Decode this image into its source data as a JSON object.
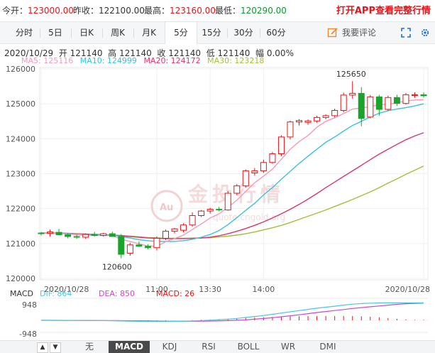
{
  "quote": {
    "open_label": "今开：",
    "open_value": "123000.00",
    "prev_label": "昨收：",
    "prev_value": "122100.00",
    "high_label": "最高：",
    "high_value": "123160.00",
    "low_label": "最低：",
    "low_value": "120290.00",
    "app_promo": "打开APP查看完整行情"
  },
  "tabs": [
    "分时",
    "5日",
    "日K",
    "周K",
    "月K",
    "5分",
    "15分",
    "30分",
    "60分"
  ],
  "active_tab": "5分",
  "comment_label": "我要评论",
  "info": {
    "date": "2020/10/29",
    "open_label": "开",
    "open": "121140",
    "high_label": "高",
    "high": "121140",
    "close_label": "收",
    "close": "121140",
    "low_label": "低",
    "low": "121140",
    "amp_label": "幅",
    "amp": "0.00%"
  },
  "ma": {
    "ma5": "MA5: 125116",
    "ma10": "MA10: 124999",
    "ma20": "MA20: 124172",
    "ma30": "MA30: 123218"
  },
  "colors": {
    "up": "#e0161a",
    "down": "#1ba32c",
    "ma5": "#f39bb6",
    "ma10": "#3cc1dc",
    "ma20": "#d6386b",
    "ma30": "#a5be3a",
    "dif": "#4cc6dc",
    "dea": "#c74bc2"
  },
  "macd": {
    "title": "MACD",
    "dif": "DIF: 864",
    "dea": "DEA: 850",
    "macd": "MACD: 26",
    "ytop": "948",
    "ybot": "-948"
  },
  "bottom_tabs": [
    "无",
    "MACD",
    "KDJ",
    "RSI",
    "BOLL",
    "WR",
    "DMI"
  ],
  "active_bottom_tab": "MACD",
  "watermark": "金投行情",
  "watermark_url": "quote.cngold.org",
  "chart_data": {
    "type": "candlestick",
    "y_ticks": [
      "126000",
      "125000",
      "124000",
      "123000",
      "122000",
      "121000",
      "120000"
    ],
    "ylim": [
      120000,
      126000
    ],
    "x_ticks": [
      "2020/10/28",
      "11:00",
      "13:30",
      "14:00",
      "2020/10/28"
    ],
    "max_label": "125650",
    "min_label": "120600",
    "candles": [
      {
        "o": 121300,
        "h": 121330,
        "l": 121230,
        "c": 121290
      },
      {
        "o": 121290,
        "h": 121400,
        "l": 121200,
        "c": 121330
      },
      {
        "o": 121320,
        "h": 121420,
        "l": 121230,
        "c": 121250
      },
      {
        "o": 121250,
        "h": 121290,
        "l": 121150,
        "c": 121200
      },
      {
        "o": 121200,
        "h": 121260,
        "l": 121130,
        "c": 121180
      },
      {
        "o": 121180,
        "h": 121290,
        "l": 121130,
        "c": 121260
      },
      {
        "o": 121260,
        "h": 121330,
        "l": 121200,
        "c": 121230
      },
      {
        "o": 121230,
        "h": 121310,
        "l": 121200,
        "c": 121280
      },
      {
        "o": 121280,
        "h": 121340,
        "l": 121230,
        "c": 121200
      },
      {
        "o": 121200,
        "h": 121270,
        "l": 120580,
        "c": 120690
      },
      {
        "o": 120720,
        "h": 121020,
        "l": 120650,
        "c": 120960
      },
      {
        "o": 120960,
        "h": 121060,
        "l": 120900,
        "c": 120920
      },
      {
        "o": 120920,
        "h": 120980,
        "l": 120830,
        "c": 120880
      },
      {
        "o": 120880,
        "h": 121200,
        "l": 120800,
        "c": 121150
      },
      {
        "o": 121150,
        "h": 121400,
        "l": 121100,
        "c": 121350
      },
      {
        "o": 121350,
        "h": 121450,
        "l": 121290,
        "c": 121420
      },
      {
        "o": 121380,
        "h": 121580,
        "l": 121320,
        "c": 121530
      },
      {
        "o": 121530,
        "h": 121890,
        "l": 121480,
        "c": 121800
      },
      {
        "o": 121800,
        "h": 121960,
        "l": 121760,
        "c": 121930
      },
      {
        "o": 121930,
        "h": 122020,
        "l": 121860,
        "c": 121980
      },
      {
        "o": 121980,
        "h": 122050,
        "l": 121920,
        "c": 121960
      },
      {
        "o": 121960,
        "h": 122500,
        "l": 121940,
        "c": 122440
      },
      {
        "o": 122440,
        "h": 122700,
        "l": 122380,
        "c": 122650
      },
      {
        "o": 122650,
        "h": 123120,
        "l": 122600,
        "c": 123080
      },
      {
        "o": 123020,
        "h": 123160,
        "l": 122950,
        "c": 123080
      },
      {
        "o": 123080,
        "h": 123400,
        "l": 123020,
        "c": 123320
      },
      {
        "o": 123320,
        "h": 123620,
        "l": 123280,
        "c": 123570
      },
      {
        "o": 123570,
        "h": 124100,
        "l": 123500,
        "c": 124050
      },
      {
        "o": 124050,
        "h": 124520,
        "l": 123980,
        "c": 124480
      },
      {
        "o": 124480,
        "h": 124560,
        "l": 124380,
        "c": 124520
      },
      {
        "o": 124470,
        "h": 124550,
        "l": 124400,
        "c": 124510
      },
      {
        "o": 124510,
        "h": 124660,
        "l": 124460,
        "c": 124610
      },
      {
        "o": 124610,
        "h": 124700,
        "l": 124560,
        "c": 124660
      },
      {
        "o": 124660,
        "h": 124860,
        "l": 124610,
        "c": 124810
      },
      {
        "o": 124810,
        "h": 125320,
        "l": 124760,
        "c": 125250
      },
      {
        "o": 125250,
        "h": 125650,
        "l": 125150,
        "c": 125300
      },
      {
        "o": 125300,
        "h": 125480,
        "l": 124360,
        "c": 124580
      },
      {
        "o": 124620,
        "h": 125250,
        "l": 124580,
        "c": 125200
      },
      {
        "o": 125200,
        "h": 125260,
        "l": 124660,
        "c": 124840
      },
      {
        "o": 124840,
        "h": 125230,
        "l": 124800,
        "c": 125180
      },
      {
        "o": 125180,
        "h": 125260,
        "l": 124940,
        "c": 125010
      },
      {
        "o": 125010,
        "h": 125310,
        "l": 124980,
        "c": 125260
      },
      {
        "o": 125240,
        "h": 125330,
        "l": 125170,
        "c": 125260
      },
      {
        "o": 125260,
        "h": 125330,
        "l": 125180,
        "c": 125230
      }
    ],
    "ma5": [
      121300,
      121300,
      121290,
      121270,
      121250,
      121230,
      121230,
      121230,
      121230,
      121120,
      121060,
      120990,
      120930,
      120920,
      121050,
      121140,
      121240,
      121400,
      121560,
      121730,
      121850,
      122040,
      122240,
      122490,
      122740,
      122930,
      123130,
      123410,
      123700,
      123920,
      124090,
      124330,
      124500,
      124600,
      124720,
      124850,
      124880,
      124920,
      124970,
      124990,
      125030,
      125080,
      125110,
      125116
    ],
    "ma10": [
      121300,
      121300,
      121290,
      121280,
      121270,
      121260,
      121250,
      121240,
      121240,
      121200,
      121160,
      121110,
      121080,
      121060,
      121060,
      121060,
      121080,
      121120,
      121180,
      121260,
      121370,
      121540,
      121740,
      121950,
      122150,
      122390,
      122600,
      122840,
      123070,
      123290,
      123500,
      123700,
      123900,
      124050,
      124220,
      124380,
      124500,
      124620,
      124730,
      124800,
      124850,
      124890,
      124940,
      124999
    ],
    "ma20": [
      121300,
      121300,
      121300,
      121290,
      121280,
      121270,
      121260,
      121250,
      121240,
      121220,
      121200,
      121180,
      121160,
      121150,
      121140,
      121140,
      121140,
      121150,
      121160,
      121180,
      121220,
      121280,
      121350,
      121430,
      121520,
      121620,
      121730,
      121850,
      121980,
      122120,
      122270,
      122430,
      122600,
      122760,
      122920,
      123080,
      123240,
      123400,
      123560,
      123700,
      123840,
      123970,
      124080,
      124172
    ],
    "ma30": [
      121300,
      121300,
      121300,
      121290,
      121280,
      121270,
      121260,
      121250,
      121240,
      121230,
      121210,
      121190,
      121170,
      121160,
      121150,
      121150,
      121150,
      121150,
      121160,
      121170,
      121190,
      121210,
      121240,
      121280,
      121330,
      121390,
      121450,
      121520,
      121600,
      121690,
      121780,
      121870,
      121960,
      122060,
      122160,
      122260,
      122370,
      122480,
      122600,
      122730,
      122850,
      122980,
      123100,
      123218
    ],
    "dif": [
      0,
      0,
      -2,
      -4,
      -6,
      -8,
      -10,
      -14,
      -20,
      -30,
      -40,
      -48,
      -56,
      -60,
      -58,
      -52,
      -44,
      -30,
      -12,
      8,
      30,
      60,
      95,
      140,
      190,
      240,
      300,
      360,
      420,
      480,
      540,
      600,
      650,
      700,
      750,
      800,
      830,
      850,
      860,
      864,
      864,
      864,
      864,
      864
    ],
    "dea": [
      0,
      0,
      -1,
      -2,
      -3,
      -5,
      -7,
      -9,
      -12,
      -16,
      -21,
      -26,
      -32,
      -37,
      -41,
      -44,
      -45,
      -44,
      -41,
      -36,
      -28,
      -15,
      2,
      25,
      55,
      90,
      130,
      175,
      225,
      275,
      330,
      385,
      435,
      485,
      535,
      585,
      630,
      670,
      710,
      750,
      790,
      820,
      840,
      850
    ],
    "macd": [
      0,
      0,
      -1,
      -2,
      -3,
      -3,
      -3,
      -5,
      -8,
      -14,
      -19,
      -22,
      -24,
      -23,
      -17,
      -8,
      1,
      14,
      29,
      44,
      58,
      75,
      93,
      115,
      135,
      150,
      170,
      185,
      195,
      205,
      210,
      215,
      215,
      215,
      215,
      215,
      200,
      180,
      150,
      114,
      74,
      44,
      24,
      26
    ]
  }
}
